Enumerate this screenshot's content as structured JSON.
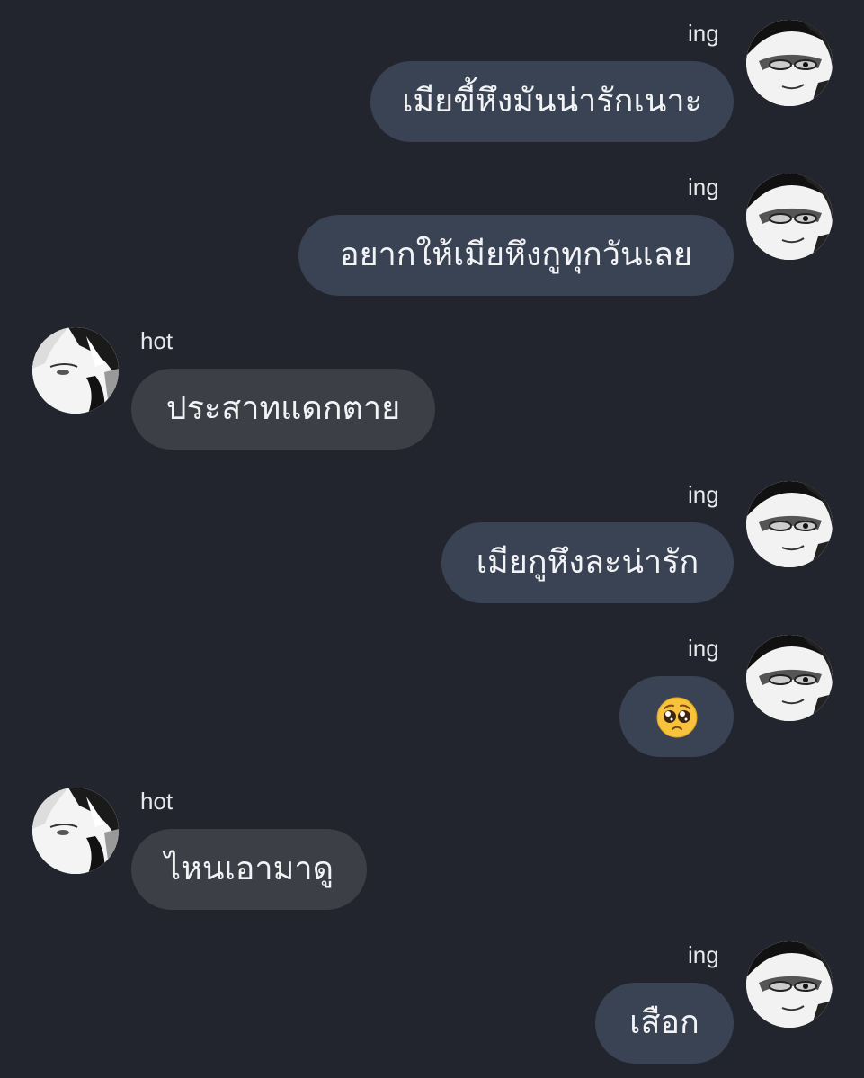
{
  "conversation": {
    "messages": [
      {
        "sender": "ing",
        "text": "เมียขี้หึงมันน่ารักเนาะ",
        "direction": "outgoing"
      },
      {
        "sender": "ing",
        "text": "อยากให้เมียหึงกูทุกวันเลย",
        "direction": "outgoing"
      },
      {
        "sender": "hot",
        "text": "ประสาทแดกตาย",
        "direction": "incoming"
      },
      {
        "sender": "ing",
        "text": "เมียกูหึงละน่ารัก",
        "direction": "outgoing"
      },
      {
        "sender": "ing",
        "text": "🥺",
        "direction": "outgoing",
        "icon": "pleading-face-emoji"
      },
      {
        "sender": "hot",
        "text": "ไหนเอามาดู",
        "direction": "incoming"
      },
      {
        "sender": "ing",
        "text": "เสือก",
        "direction": "outgoing"
      }
    ]
  },
  "colors": {
    "background": "#22252d",
    "outgoing_bubble": "#3a4354",
    "incoming_bubble": "#3d3f46",
    "text": "#f2f3f5"
  }
}
